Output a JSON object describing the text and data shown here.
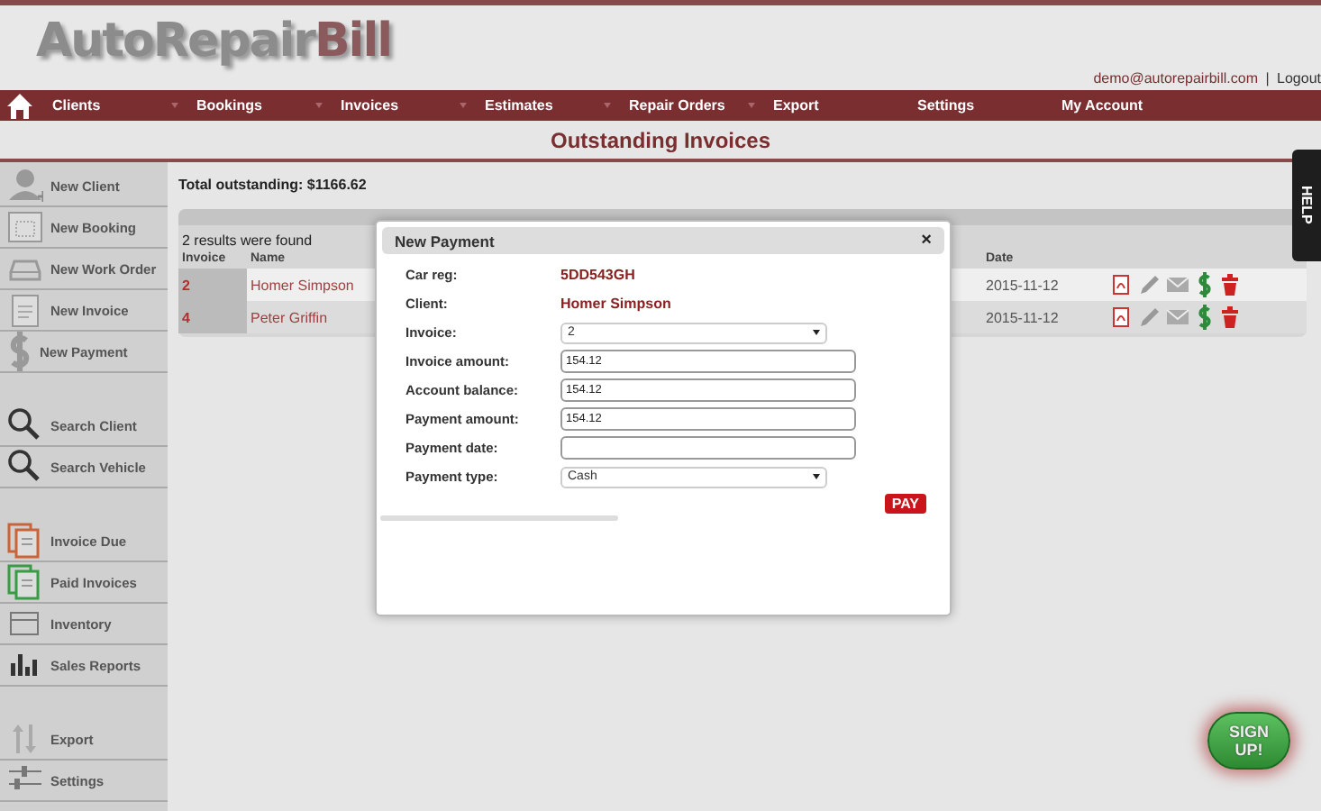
{
  "logo": {
    "light": "AutoRepair",
    "dark": "Bill"
  },
  "user_links": {
    "email": "demo@autorepairbill.com",
    "separator": "|",
    "logout": "Logout"
  },
  "nav": {
    "items": [
      {
        "label": "Clients",
        "has_menu": true
      },
      {
        "label": "Bookings",
        "has_menu": true
      },
      {
        "label": "Invoices",
        "has_menu": true
      },
      {
        "label": "Estimates",
        "has_menu": true
      },
      {
        "label": "Repair Orders",
        "has_menu": true
      },
      {
        "label": "Export",
        "has_menu": false
      },
      {
        "label": "Settings",
        "has_menu": false
      },
      {
        "label": "My Account",
        "has_menu": false
      }
    ]
  },
  "page_title": "Outstanding Invoices",
  "sidebar": {
    "groups": [
      [
        {
          "label": "New Client"
        },
        {
          "label": "New Booking"
        },
        {
          "label": "New Work Order"
        },
        {
          "label": "New Invoice"
        },
        {
          "label": "New Payment"
        }
      ],
      [
        {
          "label": "Search Client"
        },
        {
          "label": "Search Vehicle"
        }
      ],
      [
        {
          "label": "Invoice Due"
        },
        {
          "label": "Paid Invoices"
        },
        {
          "label": "Inventory"
        },
        {
          "label": "Sales Reports"
        }
      ],
      [
        {
          "label": "Export"
        },
        {
          "label": "Settings"
        }
      ]
    ]
  },
  "summary": "Total outstanding: $1166.62",
  "results": {
    "count_text": "2 results were found",
    "columns": [
      "Invoice",
      "Name",
      "Date"
    ],
    "rows": [
      {
        "invoice": "2",
        "name": "Homer Simpson",
        "date": "2015-11-12",
        "highlighted": true
      },
      {
        "invoice": "4",
        "name": "Peter Griffin",
        "date": "2015-11-12",
        "highlighted": false
      }
    ]
  },
  "modal": {
    "title": "New Payment",
    "close": "×",
    "fields": [
      {
        "kind": "text",
        "label": "Car reg:",
        "value": "5DD543GH"
      },
      {
        "kind": "text",
        "label": "Client:",
        "value": "Homer Simpson"
      },
      {
        "kind": "select",
        "label": "Invoice:",
        "value": "2"
      },
      {
        "kind": "input",
        "label": "Invoice amount:",
        "value": "154.12"
      },
      {
        "kind": "input",
        "label": "Account balance:",
        "value": "154.12"
      },
      {
        "kind": "input",
        "label": "Payment amount:",
        "value": "154.12"
      },
      {
        "kind": "input",
        "label": "Payment date:"
      },
      {
        "kind": "select",
        "label": "Payment type:",
        "value": "Cash"
      }
    ],
    "pay_button": "PAY"
  },
  "help_tab": "HELP",
  "signup": "SIGN UP!"
}
